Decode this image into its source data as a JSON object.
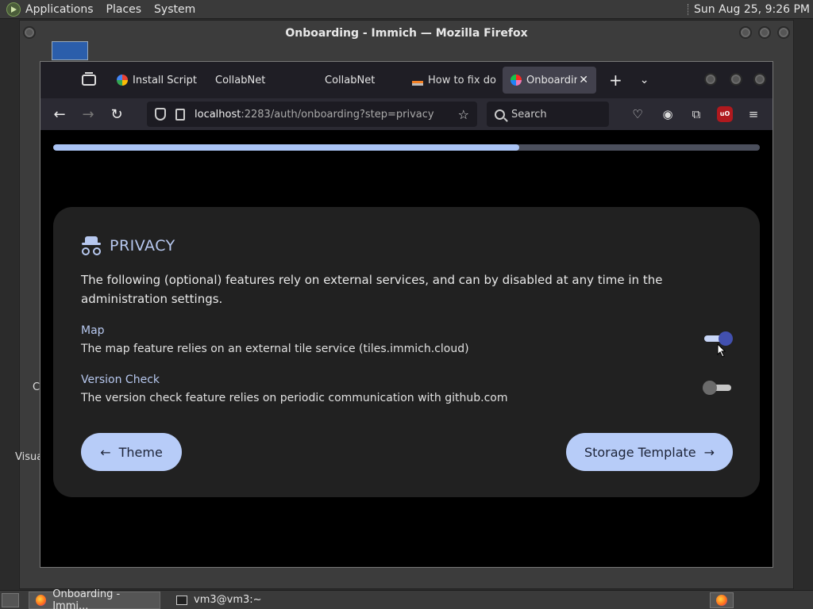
{
  "top_panel": {
    "menus": [
      "Applications",
      "Places",
      "System"
    ],
    "clock": "Sun Aug 25,  9:26 PM"
  },
  "desktop": {
    "left_text_1": "C",
    "left_text_2": "Visua"
  },
  "window": {
    "title": "Onboarding - Immich — Mozilla Firefox"
  },
  "tabs": [
    {
      "label": "Install Script",
      "favicon_color": "#ea4335"
    },
    {
      "label": "CollabNet",
      "favicon_color": ""
    },
    {
      "label": "CollabNet",
      "favicon_color": ""
    },
    {
      "label": "How to fix do",
      "favicon_color": "#f48024"
    },
    {
      "label": "Onboarding",
      "favicon_color": "#fa2921",
      "active": true
    }
  ],
  "url": {
    "host": "localhost",
    "rest": ":2283/auth/onboarding?step=privacy"
  },
  "search": {
    "placeholder": "Search"
  },
  "onboarding": {
    "progress_percent": 66,
    "title": "PRIVACY",
    "description": "The following (optional) features rely on external services, and can by disabled at any time in the administration settings.",
    "settings": [
      {
        "title": "Map",
        "description": "The map feature relies on an external tile service (tiles.immich.cloud)",
        "enabled": true
      },
      {
        "title": "Version Check",
        "description": "The version check feature relies on periodic communication with github.com",
        "enabled": false
      }
    ],
    "back_button": "Theme",
    "next_button": "Storage Template"
  },
  "taskbar": {
    "items": [
      {
        "label": "Onboarding - Immi...",
        "active": true
      },
      {
        "label": "vm3@vm3:~",
        "active": false
      }
    ]
  },
  "colors": {
    "accent": "#b7ccf8",
    "toggle_on": "#4250af",
    "card_bg": "#212121"
  }
}
